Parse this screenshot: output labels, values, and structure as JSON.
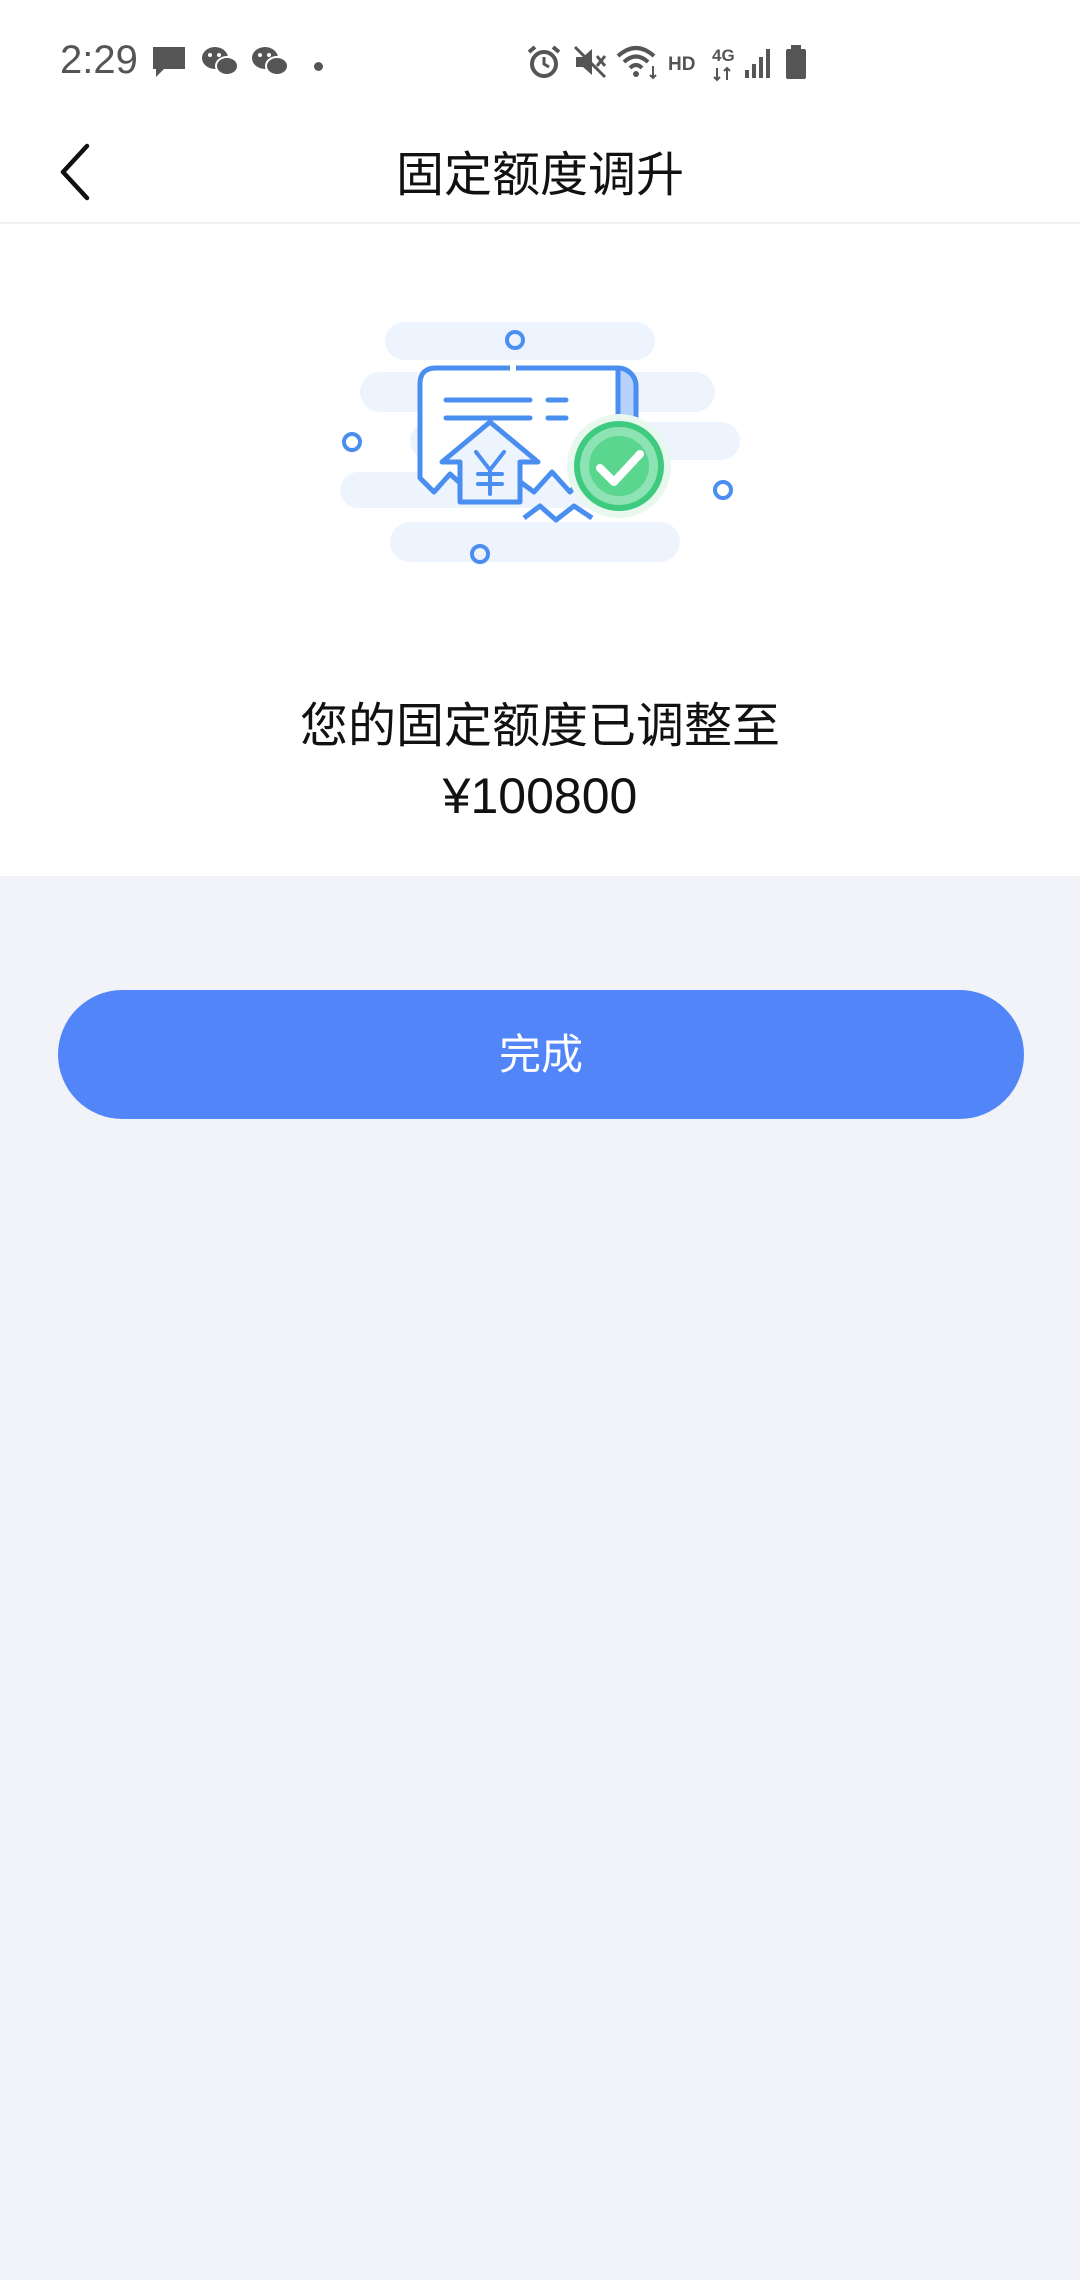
{
  "status_bar": {
    "time": "2:29",
    "network_label": "HD",
    "cell_label": "4G",
    "icons": [
      "message-icon",
      "wechat-icon",
      "wechat-icon",
      "alarm-icon",
      "mute-icon",
      "wifi-icon",
      "signal-icon",
      "battery-icon"
    ]
  },
  "header": {
    "title": "固定额度调升",
    "back_icon": "chevron-left-icon"
  },
  "result": {
    "illustration_icon": "receipt-success-icon",
    "message": "您的固定额度已调整至",
    "amount": "¥100800"
  },
  "actions": {
    "done_label": "完成"
  },
  "colors": {
    "accent": "#5286f8",
    "success": "#3ecb7f",
    "illustration_blue": "#4a8ef0",
    "background": "#f1f3f8"
  }
}
